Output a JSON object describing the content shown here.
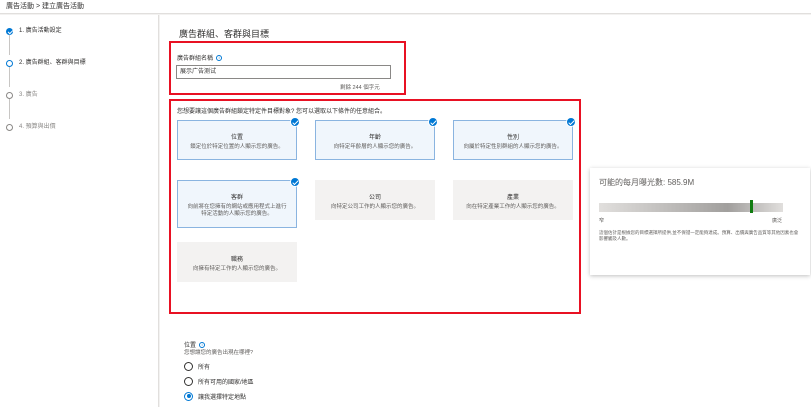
{
  "breadcrumb": {
    "text": "廣告活動 > 建立廣告活動"
  },
  "steps": [
    {
      "label": "1. 廣告活動設定",
      "state": "done"
    },
    {
      "label": "2. 廣告群組、客群與目標",
      "state": "current"
    },
    {
      "label": "3. 廣告",
      "state": "pending"
    },
    {
      "label": "4. 預算與出價",
      "state": "pending"
    }
  ],
  "main": {
    "heading": "廣告群組、客群與目標",
    "ad_group_label": "廣告群組名稱",
    "ad_group_value": "展示广告测试",
    "char_remaining": "剩餘 244 個字元",
    "question": "您想要讓這個廣告群組鎖定特定件目標對象? 您可以選取以下條件的任意組合。",
    "cards": [
      {
        "title": "位置",
        "desc": "鎖定位於特定位置的人顯示您的廣告。",
        "selected": true
      },
      {
        "title": "年齡",
        "desc": "向特定年齡層的人顯示您的廣告。",
        "selected": true
      },
      {
        "title": "性別",
        "desc": "向屬於特定性別群組的人顯示您的廣告。",
        "selected": true
      },
      {
        "title": "客群",
        "desc": "向前將在您擁有的網站或應用程式上進行特定活動的人顯示您的廣告。",
        "selected": true
      },
      {
        "title": "公司",
        "desc": "向特定公司工作的人顯示您的廣告。",
        "selected": false
      },
      {
        "title": "產業",
        "desc": "向在特定產業工作的人顯示您的廣告。",
        "selected": false
      },
      {
        "title": "職務",
        "desc": "向擁有特定工作的人顯示您的廣告。",
        "selected": false
      }
    ],
    "location_title": "位置",
    "location_sub": "您想讓您的廣告出現在哪裡?",
    "location_options": [
      {
        "label": "所有",
        "selected": false
      },
      {
        "label": "所有可用的國家/地區",
        "selected": false
      },
      {
        "label": "讓我選擇特定地點",
        "selected": true
      }
    ]
  },
  "audience": {
    "title": "可能的每月曝光數: 585.9M",
    "level": 0.82,
    "low_label": "窄",
    "high_label": "廣泛",
    "note": "這個估計是根據您的目標選擇所提供,並不保證一定能夠達成。預算、出價與廣告品質等其他因素也會影響觸及人數。"
  },
  "colors": {
    "accent": "#0078d4",
    "highlight": "#e81123",
    "gauge_marker": "#107c10"
  }
}
